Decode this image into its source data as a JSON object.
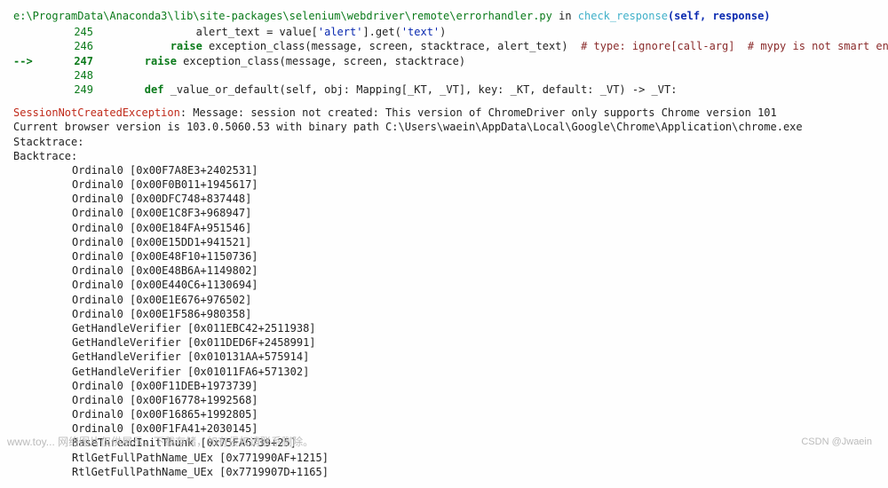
{
  "header": {
    "file_path": "e:\\ProgramData\\Anaconda3\\lib\\site-packages\\selenium\\webdriver\\remote\\errorhandler.py",
    "in_word": " in ",
    "func": "check_response",
    "sig": "(self, response)"
  },
  "code": {
    "l245_num": "245",
    "l245": "            alert_text = value['alert'].get('text')",
    "l246_num": "246",
    "l246_a": "        raise",
    "l246_b": " exception_class(message, screen, stacktrace, alert_text)  ",
    "l246_c": "# type: ignore[call-arg]  # mypy is not smart enough here",
    "arrow": "-->",
    "l247_num": "247",
    "l247_a": "    raise",
    "l247_b": " exception_class(message, screen, stacktrace)",
    "l248_num": "248",
    "l249_num": "249",
    "l249_a": "    def",
    "l249_b": " _value_or_default(self, obj: Mapping[_KT, _VT], key: _KT, default: _VT) -> _VT:"
  },
  "error": {
    "name": "SessionNotCreatedException",
    "msg_label": ": Message: ",
    "msg1": "session not created: This version of ChromeDriver only supports Chrome version 101",
    "msg2": "Current browser version is 103.0.5060.53 with binary path C:\\Users\\waein\\AppData\\Local\\Google\\Chrome\\Application\\chrome.exe",
    "stk_label": "Stacktrace:",
    "bt_label": "Backtrace:"
  },
  "stack": [
    "Ordinal0 [0x00F7A8E3+2402531]",
    "Ordinal0 [0x00F0B011+1945617]",
    "Ordinal0 [0x00DFC748+837448]",
    "Ordinal0 [0x00E1C8F3+968947]",
    "Ordinal0 [0x00E184FA+951546]",
    "Ordinal0 [0x00E15DD1+941521]",
    "Ordinal0 [0x00E48F10+1150736]",
    "Ordinal0 [0x00E48B6A+1149802]",
    "Ordinal0 [0x00E440C6+1130694]",
    "Ordinal0 [0x00E1E676+976502]",
    "Ordinal0 [0x00E1F586+980358]",
    "GetHandleVerifier [0x011EBC42+2511938]",
    "GetHandleVerifier [0x011DED6F+2458991]",
    "GetHandleVerifier [0x010131AA+575914]",
    "GetHandleVerifier [0x01011FA6+571302]",
    "Ordinal0 [0x00F11DEB+1973739]",
    "Ordinal0 [0x00F16778+1992568]",
    "Ordinal0 [0x00F16865+1992805]",
    "Ordinal0 [0x00F1FA41+2030145]",
    "BaseThreadInitThunk [0x75FA6739+25]",
    "RtlGetFullPathName_UEx [0x771990AF+1215]",
    "RtlGetFullPathName_UEx [0x7719907D+1165]"
  ],
  "footer": {
    "left": "www.toy...  网络图片仅供展示，下载存储，如有侵权请联系删除。",
    "right": "CSDN @Jwaein"
  }
}
